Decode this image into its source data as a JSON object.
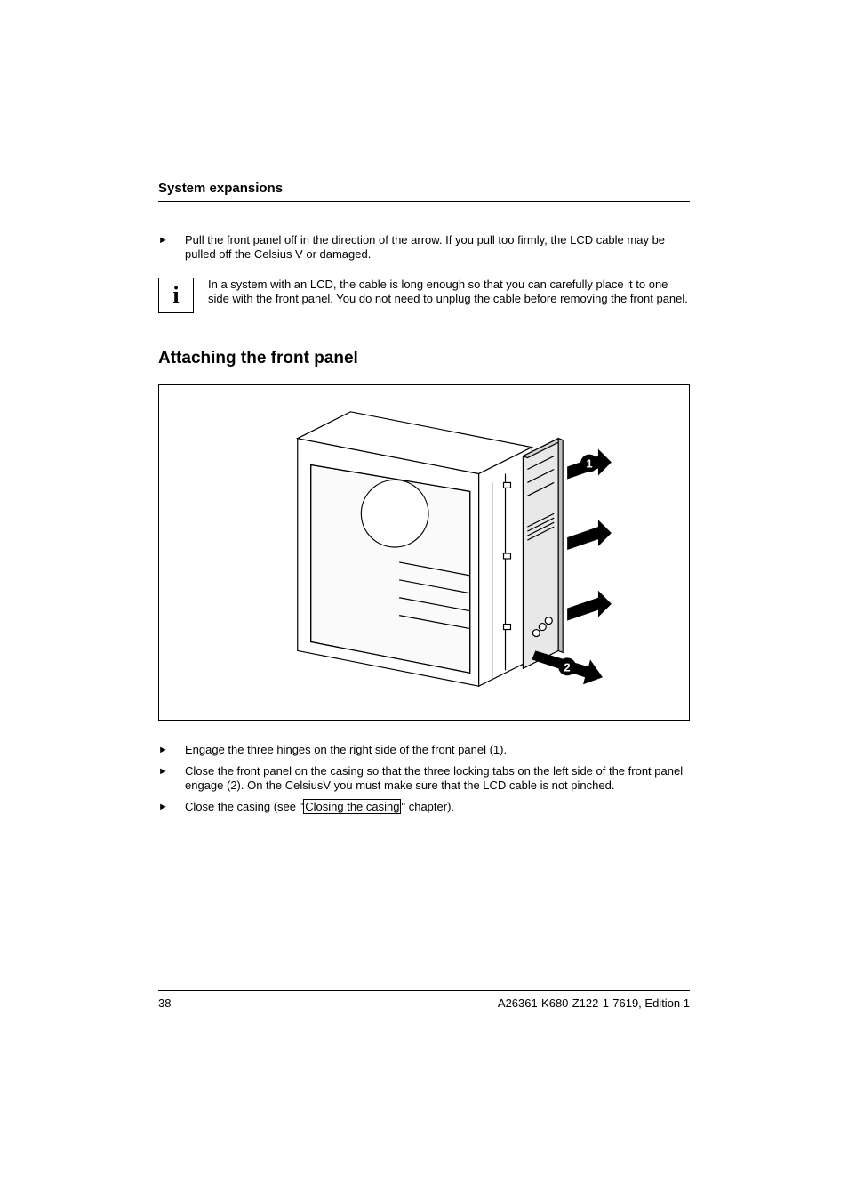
{
  "header": {
    "title": "System expansions"
  },
  "intro_bullet": {
    "text": "Pull the front panel off in the direction of the arrow. If you pull too firmly, the LCD cable may be pulled off the Celsius V or damaged."
  },
  "info_note": {
    "text": "In a system with an LCD, the cable is long enough so that you can carefully place it to one side with the front panel. You do not need to unplug the cable before removing the front panel."
  },
  "section": {
    "heading": "Attaching the front panel"
  },
  "figure": {
    "callout_1": "1",
    "callout_2": "2"
  },
  "steps": [
    {
      "text": "Engage the three hinges on the right side of the front panel (1)."
    },
    {
      "text": "Close the front panel on the casing so that the three locking tabs on the left side of the front panel engage (2). On the CelsiusV you must make sure that the LCD cable is not pinched."
    },
    {
      "prefix": "Close the casing (see \"",
      "link": "Closing the casing",
      "suffix": "\" chapter)."
    }
  ],
  "footer": {
    "page": "38",
    "docid": "A26361-K680-Z122-1-7619, Edition 1"
  }
}
